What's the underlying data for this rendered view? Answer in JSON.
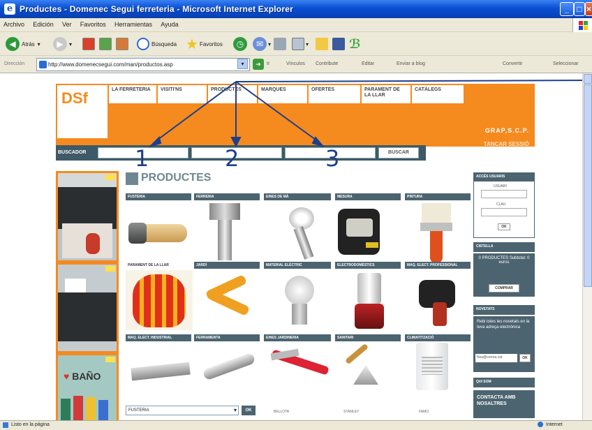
{
  "window": {
    "title": "Productes - Domenec Segui ferreteria - Microsoft Internet Explorer"
  },
  "menu": [
    "Archivo",
    "Edición",
    "Ver",
    "Favoritos",
    "Herramientas",
    "Ayuda"
  ],
  "toolbar": {
    "back": "Atrás",
    "search": "Búsqueda",
    "favorites": "Favoritos"
  },
  "address": {
    "label": "Dirección",
    "url": "http://www.domenecsegui.com/man/productos.asp",
    "go": "Ir",
    "links": "Vínculos",
    "contribute": "Contribute",
    "edit": "Editar",
    "blog": "Enviar a blog",
    "convert": "Convertir",
    "select": "Seleccionar"
  },
  "status": {
    "text": "Listo en la página",
    "zone": "Internet"
  },
  "site": {
    "logo": "DSf",
    "nav": [
      "LA FERRETERIA",
      "VISITI'NS",
      "PRODUCTES",
      "MARQUES",
      "OFERTES",
      "PARAMENT DE LA LLAR",
      "CATÀLEGS"
    ],
    "user": "GRAP,S.C.P.",
    "logout": "TANCAR SESSIÓ",
    "search_label": "BUSCADOR",
    "search_button": "BUSCAR",
    "page_title": "PRODUCTES",
    "categories_row1": [
      "FUSTERIA",
      "FERRERIA",
      "EINES DE MÀ",
      "MESURA",
      "PINTURA"
    ],
    "categories_row2": [
      "PARAMENT DE LA LLAR",
      "JARDÍ",
      "MATERIAL ELÈCTRIC",
      "ELECTRODOMÈSTICS",
      "MAQ. ELECT. PROFESSIONAL"
    ],
    "categories_row3": [
      "MAQ. ELECT. INDUSTRIAL",
      "FERRAMENTA",
      "EINES JARDINERIA",
      "SANITARI",
      "CLIMATITZACIÓ"
    ],
    "bottom_labels": [
      "BELLOTA",
      "STANLEY",
      "FAMO"
    ],
    "dropdown_value": "FUSTERIA",
    "dropdown_ok": "OK",
    "right": {
      "access_title": "ACCÉS USUARIS",
      "user_label": "USUARI",
      "pass_label": "CLAU",
      "ok": "OK",
      "cart_title": "CISTELLA",
      "cart_text": "0 PRODUCTES Subtotal: 0 euros",
      "cart_button": "COMPRAR",
      "news_title": "NOVETATS",
      "news_text": "Rebi totes les novetats en la teva adreça electrònica",
      "email_placeholder": "Nou@correu.cat",
      "news_ok": "OK",
      "who_title": "QUI SOM",
      "contact": "CONTACTA AMB NOSALTRES"
    },
    "left_banner_text": "BAÑO",
    "annotations": [
      "1",
      "2",
      "3"
    ]
  }
}
